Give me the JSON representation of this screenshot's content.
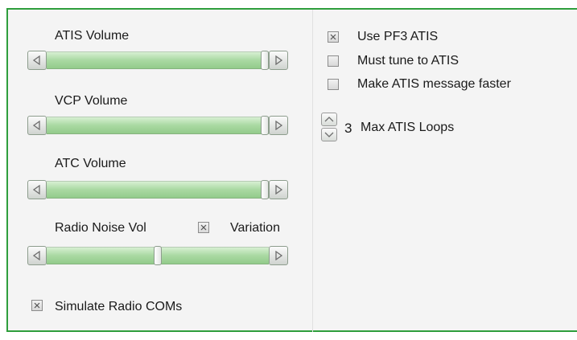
{
  "volumes": {
    "atis_label": "ATIS Volume",
    "vcp_label": "VCP Volume",
    "atc_label": "ATC Volume",
    "radio_noise_label": "Radio Noise Vol",
    "variation_label": "Variation",
    "atis_level": 1.0,
    "vcp_level": 1.0,
    "atc_level": 1.0,
    "radio_noise_level": 0.5
  },
  "options": {
    "simulate_radio_coms_label": "Simulate Radio COMs",
    "use_pf3_atis_label": "Use PF3 ATIS",
    "must_tune_label": "Must tune to ATIS",
    "faster_label": "Make ATIS message faster",
    "max_loops_value": "3",
    "max_loops_label": "Max ATIS Loops",
    "checked": {
      "variation": true,
      "simulate_radio_coms": true,
      "use_pf3_atis": true,
      "must_tune": false,
      "faster": false
    }
  },
  "colors": {
    "border": "#2e9e3c",
    "track": "#a9d9a2"
  },
  "icons": {
    "slider_left": "triangle-left-icon",
    "slider_right": "triangle-right-icon",
    "check": "x-check-icon",
    "spin_up": "chevron-up-icon",
    "spin_down": "chevron-down-icon"
  }
}
